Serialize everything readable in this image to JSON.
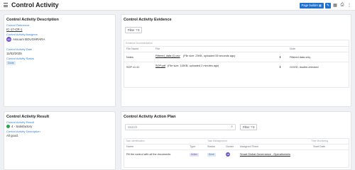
{
  "header": {
    "title": "Control Activity",
    "page_builder_label": "Page builder",
    "icons": [
      "menu-icon",
      "page-builder-icon",
      "edit-icon",
      "grid-icon",
      "print-icon",
      "more-icon"
    ]
  },
  "description": {
    "title": "Control Activity Description",
    "fields": [
      {
        "label": "Control Reference",
        "value": "IC-17-CR-1"
      },
      {
        "label": "Control Activity Assignee",
        "value": "Assoum BOUGHRARA",
        "initials": "AB"
      },
      {
        "label": "Control Activity Date",
        "value": "11/02/2025"
      },
      {
        "label": "Control Activity Status",
        "value": "Done"
      }
    ]
  },
  "result": {
    "title": "Control Activity Result",
    "result_label": "Control Activity Result",
    "result_value": "4 - Satisfactory",
    "desc_label": "Control Activity Description",
    "desc_value": "All good."
  },
  "evidence": {
    "title": "Control Activity Evidence",
    "filter_label": "Filter",
    "filter_count": "0",
    "group_header": "Evidence Documentation",
    "columns": [
      "File Name",
      "File",
      "Note"
    ],
    "rows": [
      {
        "name": "Notes",
        "file": "Filtered_data (1).csv",
        "meta": "(File size: 23KB, uploaded 55 seconds ago)",
        "note": "Filtered data only"
      },
      {
        "name": "SOP v1.41",
        "file": "SOP.pdf",
        "meta": "(File size: 115KB, uploaded 2 minutes ago)",
        "note": "GOOD, double-checked"
      }
    ]
  },
  "action_plan": {
    "title": "Control Activity Action Plan",
    "search_placeholder": "Search",
    "filter_label": "Filter",
    "filter_count": "0",
    "group_headers": [
      "Task Identification",
      "Task Management",
      "Time Monitoring"
    ],
    "columns": [
      "Name",
      "Type",
      "Status",
      "Owner",
      "Assigned Team",
      "Start Date"
    ],
    "rows": [
      {
        "name": "Fill the control with all the documents",
        "type": "Action",
        "status": "Done",
        "owner_initials": "AB",
        "team": "Smart Global Governance - Operationnels",
        "start": ""
      }
    ]
  }
}
